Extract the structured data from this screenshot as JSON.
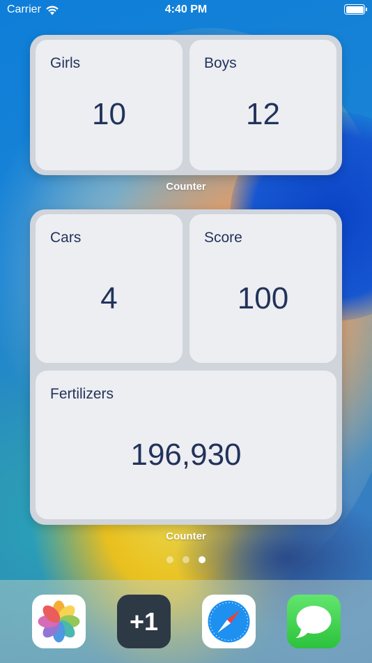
{
  "status_bar": {
    "carrier": "Carrier",
    "time": "4:40 PM",
    "battery_level": 1.0
  },
  "widgets": [
    {
      "caption": "Counter",
      "tiles": [
        {
          "label": "Girls",
          "value": "10"
        },
        {
          "label": "Boys",
          "value": "12"
        }
      ]
    },
    {
      "caption": "Counter",
      "tiles": [
        {
          "label": "Cars",
          "value": "4"
        },
        {
          "label": "Score",
          "value": "100"
        },
        {
          "label": "Fertilizers",
          "value": "196,930"
        }
      ]
    }
  ],
  "page_indicator": {
    "pages": 3,
    "current": 3
  },
  "dock": {
    "apps": [
      {
        "icon": "photos-icon"
      },
      {
        "icon": "plus-one-icon",
        "text": "+1"
      },
      {
        "icon": "safari-icon"
      },
      {
        "icon": "messages-icon"
      }
    ]
  },
  "colors": {
    "tile_background": "#edeef2",
    "widget_background": "#d0d4db",
    "tile_text": "#22335a"
  }
}
